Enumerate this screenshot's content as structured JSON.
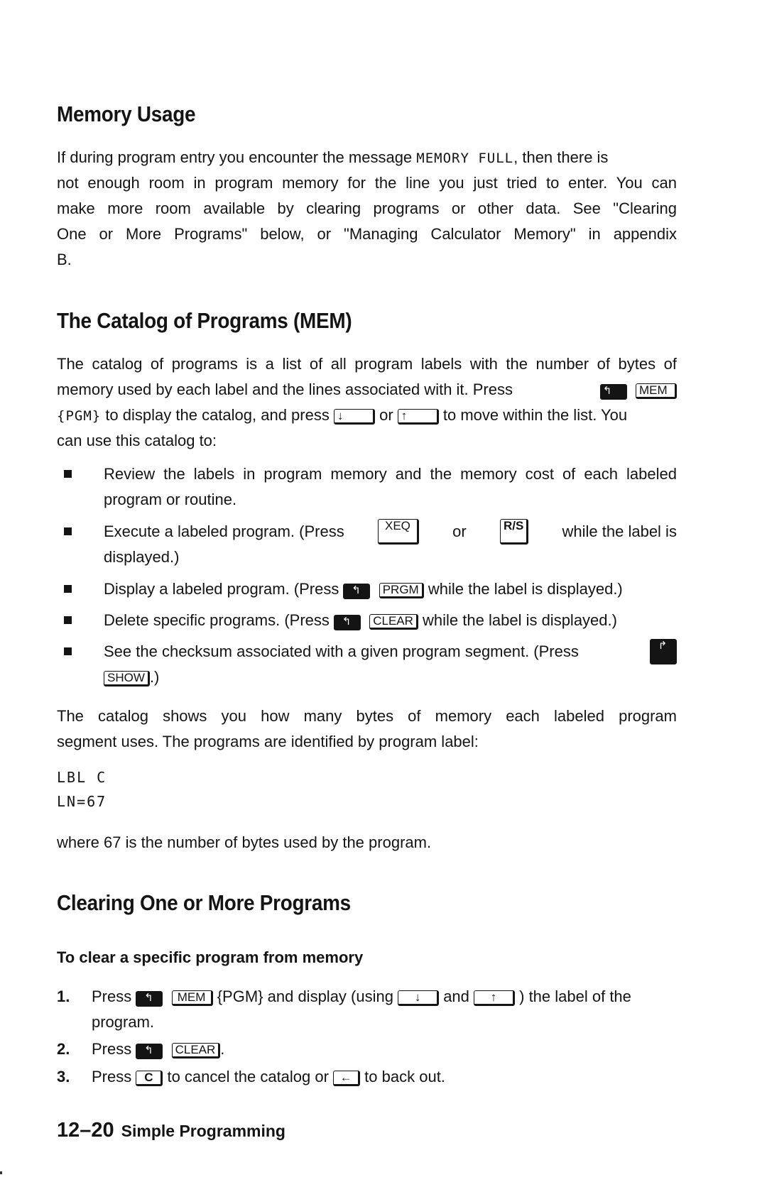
{
  "sections": {
    "memory_usage": {
      "heading": "Memory Usage",
      "para_lines": [
        [
          "If during program entry you encounter the message ",
          "MEMORY FULL",
          ", then there is"
        ],
        "not enough room in program memory for the line you just tried to enter. You can",
        "make more room available by clearing programs or other data. See \"Clearing",
        "One or More Programs\" below, or \"Managing Calculator Memory\" in appendix",
        "B."
      ]
    },
    "catalog": {
      "heading": "The Catalog of Programs (MEM)",
      "intro": {
        "l1": "The catalog of programs is a list of all program labels with the number of bytes of",
        "l2a": "memory used by each label and the lines associated with it. Press",
        "l3a": "{PGM}",
        "l3b": " to display the catalog, and press ",
        "l3c": " or ",
        "l3d": " to move within the list. You",
        "l4": "can use this catalog to:"
      },
      "bullets": {
        "b1_l1": "Review the labels in program memory and the memory cost of each labeled",
        "b1_l2": "program or routine.",
        "b2_a": "Execute a labeled program. (Press",
        "b2_b": "or",
        "b2_c": "while the label is",
        "b2_l2": "displayed.)",
        "b3_a": "Display a labeled program. (Press ",
        "b3_b": " while the label is displayed.)",
        "b4_a": "Delete specific programs. (Press ",
        "b4_b": " while the label is displayed.)",
        "b5_l1": "See the checksum associated with a given program segment. (Press",
        "b5_l2": ".)"
      },
      "outro_l1": "The catalog shows you how many bytes of memory each labeled program",
      "outro_l2": "segment uses. The programs are identified by program label:",
      "display": [
        "LBL C",
        "LN=67"
      ],
      "where": "where 67 is the number of bytes used by the program."
    },
    "clearing": {
      "heading": "Clearing One or More Programs",
      "subheading": "To clear a specific program from memory",
      "steps": {
        "s1_num": "1.",
        "s1_a": "Press ",
        "s1_b": " {PGM} and display (using ",
        "s1_c": " and ",
        "s1_d": " ) the label of the",
        "s1_l2": "program.",
        "s2_num": "2.",
        "s2_a": "Press ",
        "s2_b": ".",
        "s3_num": "3.",
        "s3_a": "Press ",
        "s3_b": " to cancel the catalog or ",
        "s3_c": " to back out."
      }
    }
  },
  "keys": {
    "left_shift": "↰",
    "right_shift": "↱",
    "mem": "MEM",
    "down": "↓",
    "up": "↑",
    "xeq": "XEQ",
    "rs": "R/S",
    "prgm": "PRGM",
    "clear": "CLEAR",
    "show": "SHOW",
    "c": "C",
    "backspace": "←"
  },
  "footer": {
    "page_number": "12–20",
    "chapter_title": "Simple Programming"
  }
}
